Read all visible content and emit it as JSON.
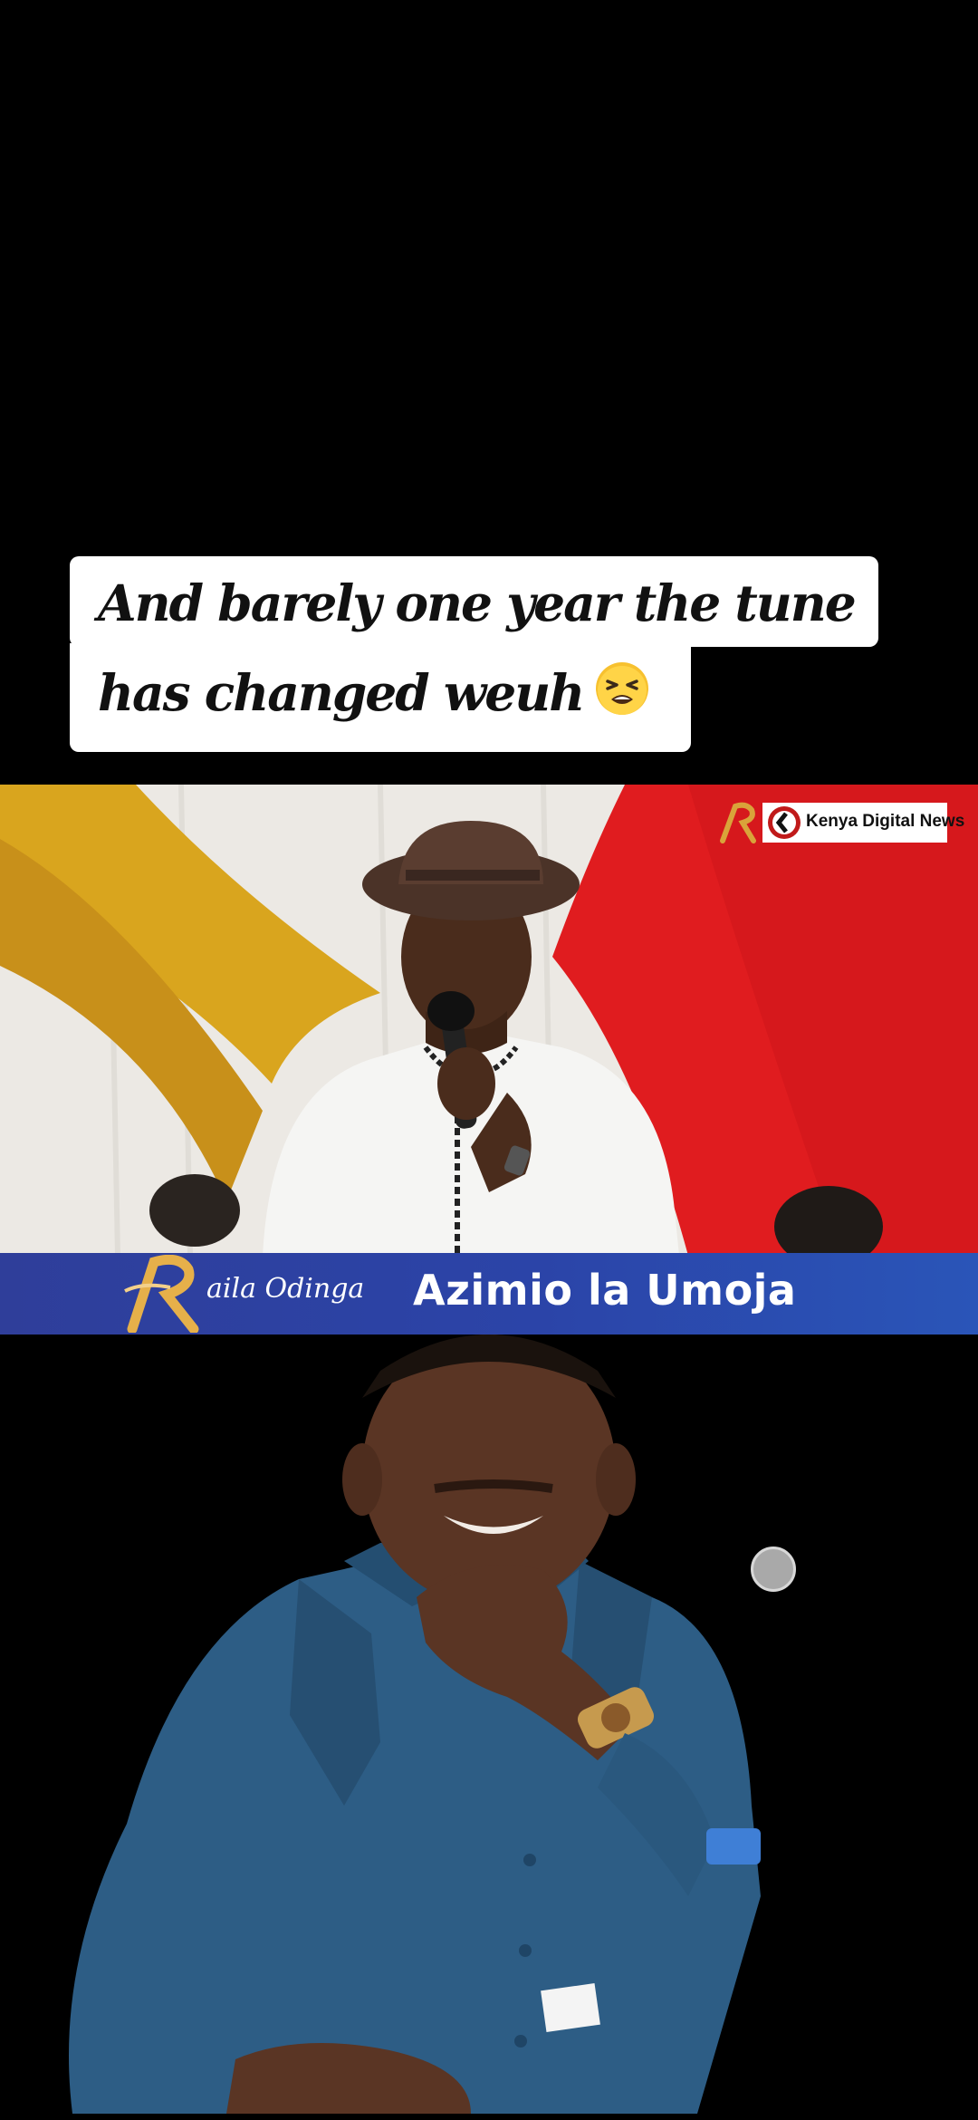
{
  "caption": {
    "line1": "And barely one year the tune",
    "line2": "has changed weuh",
    "emoji": "tired-face-emoji"
  },
  "video": {
    "watermark_text": "Kenya Digital News",
    "lower_third": {
      "name": "aila Odinga",
      "title": "Azimio la Umoja"
    }
  },
  "colors": {
    "background": "#000000",
    "caption_bg": "#ffffff",
    "lower_third": "#2b44a8",
    "curtain_red": "#e21f1f",
    "curtain_gold": "#d9a51e",
    "shirt_blue": "#2c5a80"
  },
  "icons": [
    "tired-face-emoji",
    "kenya-digital-news-logo",
    "raila-r-logo",
    "touch-indicator-dot"
  ]
}
